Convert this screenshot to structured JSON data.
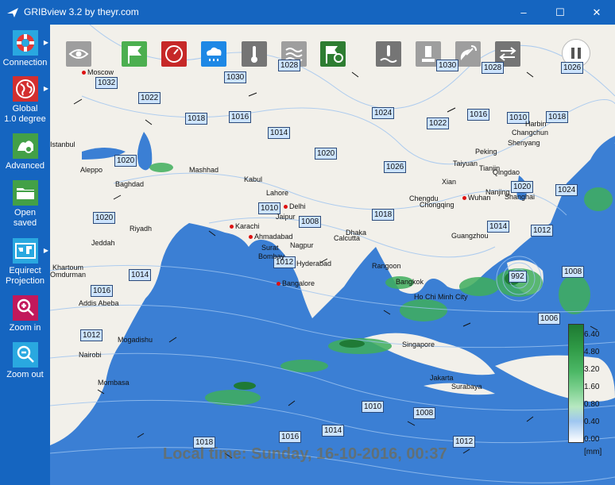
{
  "window": {
    "title": "GRIBview 3.2 by theyr.com",
    "controls": [
      "–",
      "☐",
      "✕"
    ]
  },
  "sidebar": {
    "items": [
      {
        "label": "Connection",
        "icon": "lifebuoy-icon",
        "submenu": true
      },
      {
        "label": "Global\n1.0 degree",
        "icon": "globe-icon",
        "submenu": true
      },
      {
        "label": "Advanced",
        "icon": "advanced-icon",
        "submenu": false
      },
      {
        "label": "Open\nsaved",
        "icon": "folder-icon",
        "submenu": false
      },
      {
        "label": "Equirect\nProjection",
        "icon": "world-map-icon",
        "submenu": true
      },
      {
        "label": "Zoom in",
        "icon": "zoom-in-icon",
        "submenu": false
      },
      {
        "label": "Zoom out",
        "icon": "zoom-out-icon",
        "submenu": false
      }
    ]
  },
  "toolbar": [
    {
      "name": "eye-icon",
      "color": "#9e9e9e"
    },
    {
      "name": "flag-icon",
      "color": "#4caf50"
    },
    {
      "name": "gauge-icon",
      "color": "#c62828"
    },
    {
      "name": "rain-cloud-icon",
      "color": "#1e88e5"
    },
    {
      "name": "thermometer-icon",
      "color": "#757575"
    },
    {
      "name": "waves-icon",
      "color": "#9e9e9e"
    },
    {
      "name": "flag-clock-icon",
      "color": "#2e7d32"
    },
    {
      "name": "sea-temperature-icon",
      "color": "#757575"
    },
    {
      "name": "buoy-icon",
      "color": "#9e9e9e"
    },
    {
      "name": "satellite-dish-icon",
      "color": "#9e9e9e"
    },
    {
      "name": "swap-arrows-icon",
      "color": "#757575"
    }
  ],
  "isobars": [
    "1032",
    "1030",
    "1028",
    "1030",
    "1028",
    "1026",
    "1022",
    "1018",
    "1016",
    "1014",
    "1024",
    "1022",
    "1016",
    "1010",
    "1018",
    "1020",
    "1020",
    "1026",
    "1020",
    "1024",
    "1010",
    "1008",
    "1018",
    "1014",
    "1012",
    "1020",
    "1014",
    "1016",
    "1012",
    "1008",
    "992",
    "1006",
    "1012",
    "1010",
    "1008",
    "1016",
    "1014",
    "1018",
    "1012"
  ],
  "cities": [
    "Moscow",
    "Istanbul",
    "Aleppo",
    "Mashhad",
    "Baghdad",
    "Kabul",
    "Lahore",
    "Delhi",
    "Jaipur",
    "Riyadh",
    "Karachi",
    "Ahmadabad",
    "Surat",
    "Nagpur",
    "Hyderabad",
    "Bombay",
    "Jeddah",
    "Calcutta",
    "Dhaka",
    "Bangalore",
    "Chengdu",
    "Chongqing",
    "Xian",
    "Wuhan",
    "Nanjing",
    "Shanghai",
    "Shenyang",
    "Peking",
    "Harbin",
    "Changchun",
    "Tianjin",
    "Taiyuan",
    "Qingdao",
    "Guangzhou",
    "Rangoon",
    "Bangkok",
    "Ho Chi Minh City",
    "Singapore",
    "Jakarta",
    "Surabaya",
    "Khartoum",
    "Omdurman",
    "Addis Abeba",
    "Mogadishu",
    "Nairobi",
    "Mombasa"
  ],
  "legend": {
    "values": [
      "6.40",
      "4.80",
      "3.20",
      "1.60",
      "0.80",
      "0.40",
      "0.00"
    ],
    "unit": "[mm]"
  },
  "status": {
    "timestamp": "Local time: Sunday, 16-10-2016, 00:37"
  },
  "pause_label": "Pause"
}
